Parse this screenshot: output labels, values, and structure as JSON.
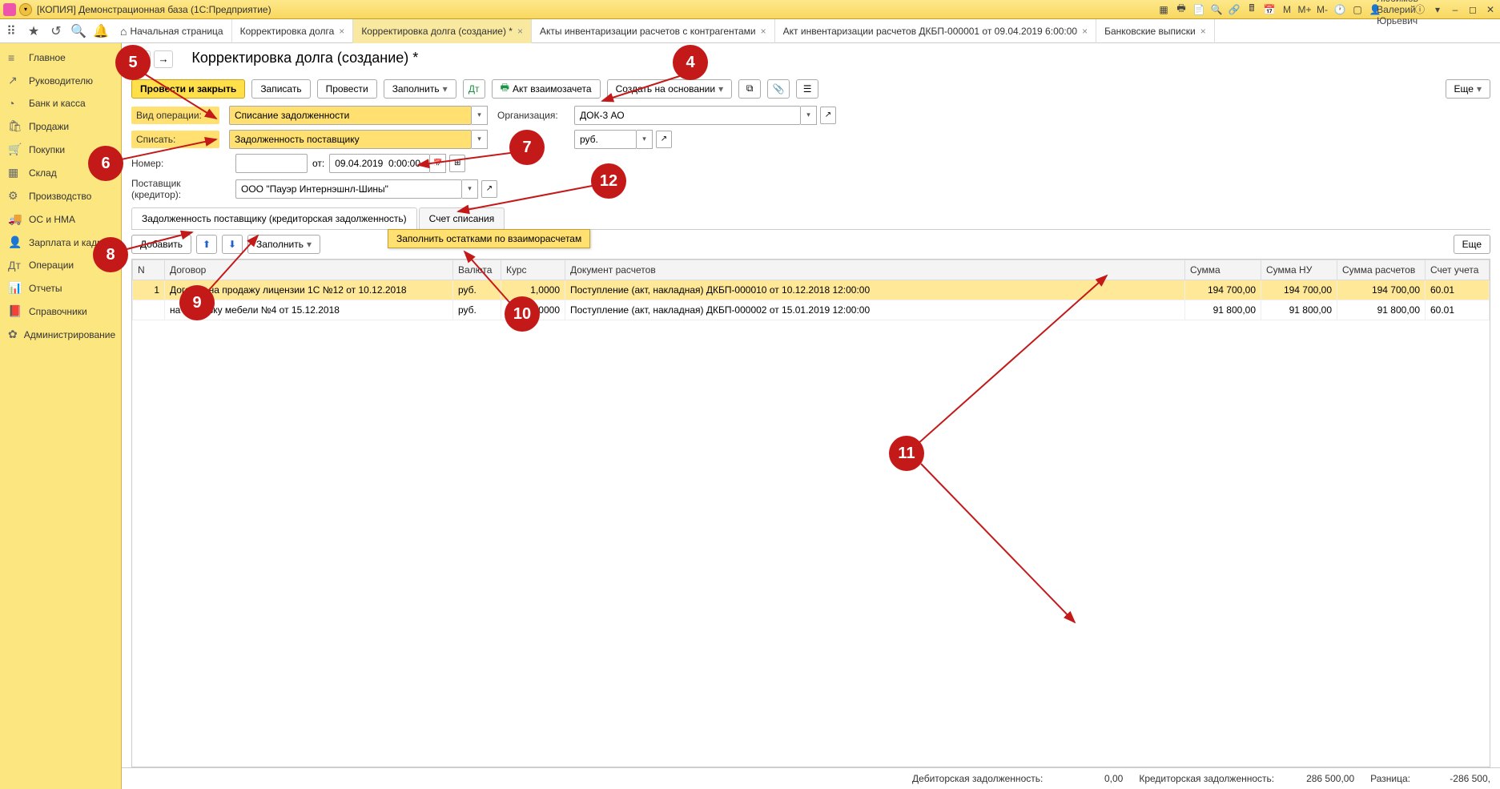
{
  "titlebar": {
    "title": "[КОПИЯ] Демонстрационная база  (1С:Предприятие)",
    "user": "Любимов Валерий Юрьевич",
    "icons_m": "M",
    "icons_mp": "M+",
    "icons_mm": "M-"
  },
  "toolbar_icons": [
    "apps",
    "star",
    "history",
    "search",
    "bell"
  ],
  "tabs": [
    {
      "label": "Начальная страница",
      "home": true,
      "closable": false
    },
    {
      "label": "Корректировка долга",
      "closable": true
    },
    {
      "label": "Корректировка долга (создание) *",
      "closable": true,
      "active": true
    },
    {
      "label": "Акты инвентаризации расчетов с контрагентами",
      "closable": true
    },
    {
      "label": "Акт инвентаризации расчетов ДКБП-000001 от 09.04.2019 6:00:00",
      "closable": true
    },
    {
      "label": "Банковские выписки",
      "closable": true
    }
  ],
  "sidebar": [
    {
      "icon": "≡",
      "label": "Главное"
    },
    {
      "icon": "↗",
      "label": "Руководителю"
    },
    {
      "icon": "◔",
      "label": "Банк и касса"
    },
    {
      "icon": "🛍",
      "label": "Продажи"
    },
    {
      "icon": "🛒",
      "label": "Покупки"
    },
    {
      "icon": "▦",
      "label": "Склад"
    },
    {
      "icon": "⚙",
      "label": "Производство"
    },
    {
      "icon": "🚚",
      "label": "ОС и НМА"
    },
    {
      "icon": "👤",
      "label": "Зарплата и кадры"
    },
    {
      "icon": "Дт",
      "label": "Операции"
    },
    {
      "icon": "📊",
      "label": "Отчеты"
    },
    {
      "icon": "📕",
      "label": "Справочники"
    },
    {
      "icon": "✿",
      "label": "Администрирование"
    }
  ],
  "page": {
    "title": "Корректировка долга (создание) *",
    "btn_post_close": "Провести и закрыть",
    "btn_write": "Записать",
    "btn_post": "Провести",
    "btn_fill": "Заполнить",
    "btn_act": "Акт взаимозачета",
    "btn_create_based": "Создать на основании",
    "btn_more": "Еще"
  },
  "form": {
    "lbl_op_type": "Вид операции:",
    "val_op_type": "Списание задолженности",
    "lbl_write_off": "Списать:",
    "val_write_off": "Задолженность поставщику",
    "lbl_org": "Организация:",
    "val_org": "ДОК-3 АО",
    "val_currency": "руб.",
    "lbl_number": "Номер:",
    "val_number": "",
    "lbl_from": "от:",
    "val_date": "09.04.2019  0:00:00",
    "lbl_supplier": "Поставщик (кредитор):",
    "val_supplier": "ООО \"Пауэр Интернэшнл-Шины\""
  },
  "subtabs": {
    "tab1": "Задолженность поставщику (кредиторская задолженность)",
    "tab2": "Счет списания"
  },
  "tblbar": {
    "btn_add": "Добавить",
    "btn_fill": "Заполнить",
    "btn_more": "Еще",
    "dd_fill_by_balance": "Заполнить остатками по взаиморасчетам"
  },
  "table": {
    "headers": {
      "n": "N",
      "contract": "Договор",
      "currency": "Валюта",
      "rate": "Курс",
      "doc": "Документ расчетов",
      "sum": "Сумма",
      "sum_nu": "Сумма НУ",
      "sum_calc": "Сумма расчетов",
      "account": "Счет учета"
    },
    "rows": [
      {
        "n": "1",
        "contract": "Договор на продажу лицензии 1С №12 от 10.12.2018",
        "currency": "руб.",
        "rate": "1,0000",
        "doc": "Поступление (акт, накладная) ДКБП-000010 от 10.12.2018 12:00:00",
        "sum": "194 700,00",
        "sum_nu": "194 700,00",
        "sum_calc": "194 700,00",
        "account": "60.01",
        "sel": true
      },
      {
        "n": "",
        "contract": "на поставку мебели №4 от 15.12.2018",
        "currency": "руб.",
        "rate": "1,0000",
        "doc": "Поступление (акт, накладная) ДКБП-000002 от 15.01.2019 12:00:00",
        "sum": "91 800,00",
        "sum_nu": "91 800,00",
        "sum_calc": "91 800,00",
        "account": "60.01"
      }
    ]
  },
  "footer": {
    "lbl_debit": "Дебиторская задолженность:",
    "val_debit": "0,00",
    "lbl_credit": "Кредиторская задолженность:",
    "val_credit": "286 500,00",
    "lbl_diff": "Разница:",
    "val_diff": "-286 500,"
  },
  "annotations": {
    "4": "4",
    "5": "5",
    "6": "6",
    "7": "7",
    "8": "8",
    "9": "9",
    "10": "10",
    "11": "11",
    "12": "12"
  }
}
